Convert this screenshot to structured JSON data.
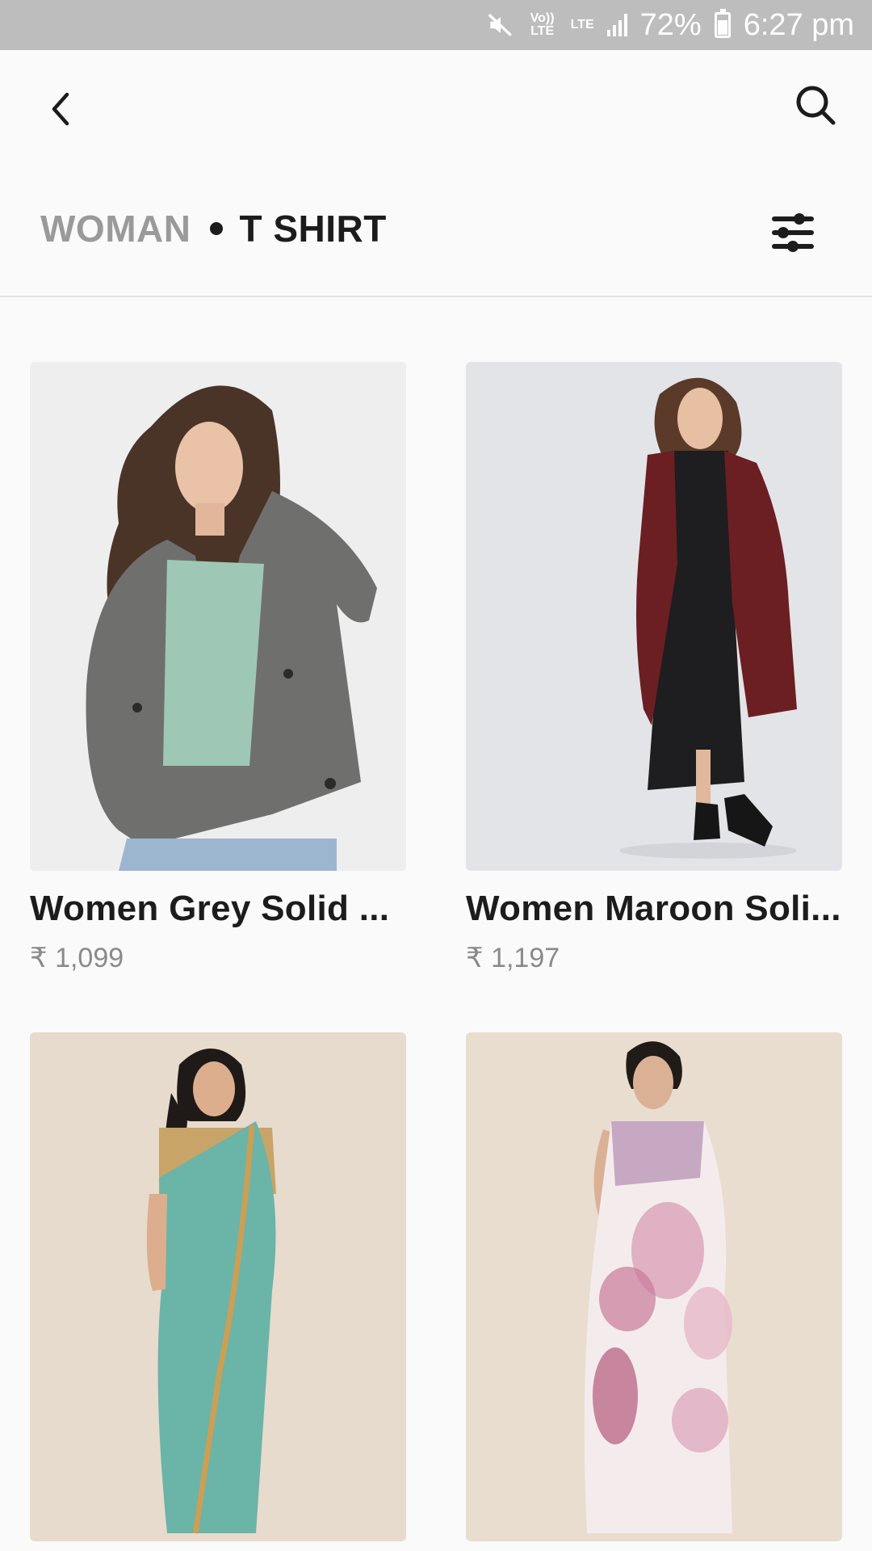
{
  "status_bar": {
    "volte_label": "Vo)) LTE",
    "lte_label": "LTE",
    "battery": "72%",
    "time": "6:27 pm"
  },
  "nav": {
    "back_icon": "chevron-left-icon",
    "search_icon": "search-icon"
  },
  "category": {
    "parent": "WOMAN",
    "current": "T SHIRT",
    "filter_icon": "sliders-icon"
  },
  "products": [
    {
      "name": "Women Grey Solid ...",
      "price": "₹ 1,099",
      "bg": "#efeeee"
    },
    {
      "name": "Women Maroon Soli...",
      "price": "₹ 1,197",
      "bg": "#e3e4e8"
    },
    {
      "name": "",
      "price": "",
      "bg": "#e7dbcd"
    },
    {
      "name": "",
      "price": "",
      "bg": "#e9ddd0"
    }
  ],
  "colors": {
    "status_bar_bg": "#bdbdbd",
    "page_bg": "#fafafa",
    "muted_text": "#9a9a9a"
  }
}
